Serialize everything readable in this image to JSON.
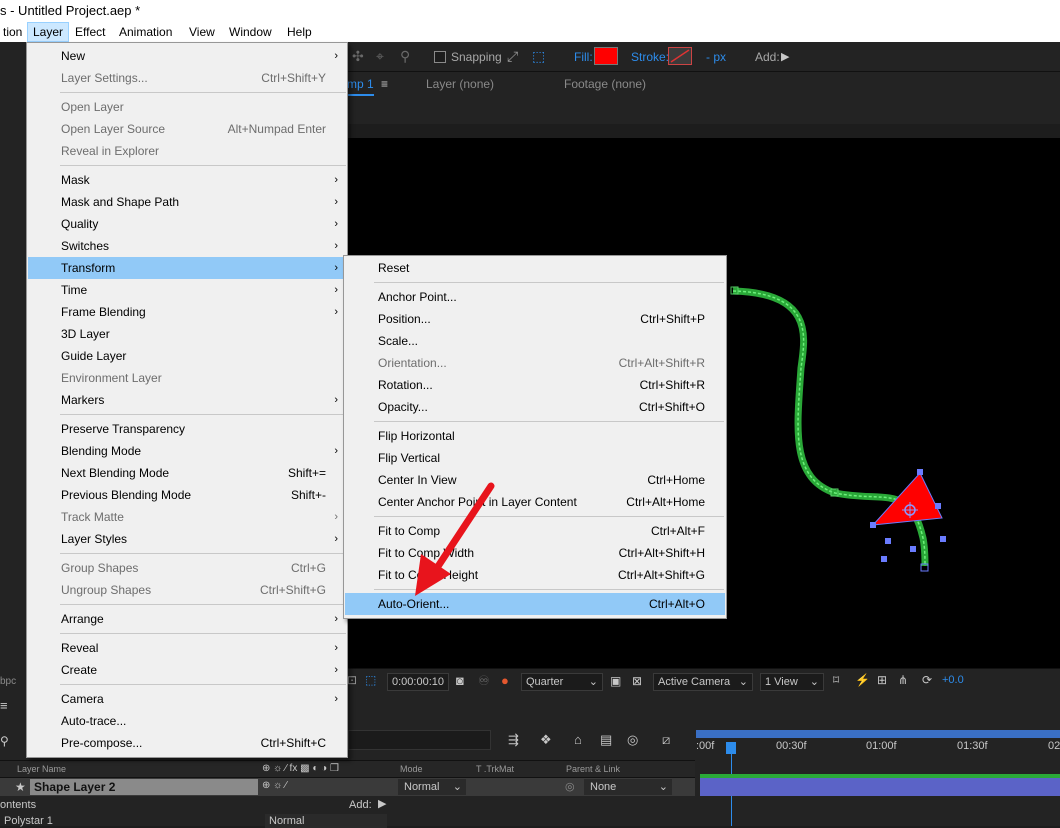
{
  "app": {
    "title": "s - Untitled Project.aep *"
  },
  "menubar": [
    "tion",
    "Layer",
    "Effect",
    "Animation",
    "View",
    "Window",
    "Help"
  ],
  "toolbar": {
    "snapping_label": "Snapping",
    "fill_label": "Fill:",
    "fill_color": "#ff0000",
    "stroke_label": "Stroke:",
    "stroke_width": "-  px",
    "add_label": "Add:"
  },
  "viewer": {
    "tabs": [
      "mp 1",
      "Layer  (none)",
      "Footage  (none)"
    ],
    "timecode": "0:00:00:10",
    "resolution": "Quarter",
    "camera": "Active Camera",
    "views": "1 View",
    "exposure": "+0.0",
    "bpc": "bpc"
  },
  "layer_menu": {
    "items": [
      {
        "label": "New",
        "shortcut": "",
        "submenu": true,
        "disabled": false
      },
      {
        "label": "Layer Settings...",
        "shortcut": "Ctrl+Shift+Y",
        "submenu": false,
        "disabled": true
      },
      {
        "label": "Open Layer",
        "shortcut": "",
        "submenu": false,
        "disabled": true
      },
      {
        "label": "Open Layer Source",
        "shortcut": "Alt+Numpad Enter",
        "submenu": false,
        "disabled": true
      },
      {
        "label": "Reveal in Explorer",
        "shortcut": "",
        "submenu": false,
        "disabled": true
      },
      {
        "label": "Mask",
        "shortcut": "",
        "submenu": true,
        "disabled": false
      },
      {
        "label": "Mask and Shape Path",
        "shortcut": "",
        "submenu": true,
        "disabled": false
      },
      {
        "label": "Quality",
        "shortcut": "",
        "submenu": true,
        "disabled": false
      },
      {
        "label": "Switches",
        "shortcut": "",
        "submenu": true,
        "disabled": false
      },
      {
        "label": "Transform",
        "shortcut": "",
        "submenu": true,
        "disabled": false
      },
      {
        "label": "Time",
        "shortcut": "",
        "submenu": true,
        "disabled": false
      },
      {
        "label": "Frame Blending",
        "shortcut": "",
        "submenu": true,
        "disabled": false
      },
      {
        "label": "3D Layer",
        "shortcut": "",
        "submenu": false,
        "disabled": false
      },
      {
        "label": "Guide Layer",
        "shortcut": "",
        "submenu": false,
        "disabled": false
      },
      {
        "label": "Environment Layer",
        "shortcut": "",
        "submenu": false,
        "disabled": true
      },
      {
        "label": "Markers",
        "shortcut": "",
        "submenu": true,
        "disabled": false
      },
      {
        "label": "Preserve Transparency",
        "shortcut": "",
        "submenu": false,
        "disabled": false
      },
      {
        "label": "Blending Mode",
        "shortcut": "",
        "submenu": true,
        "disabled": false
      },
      {
        "label": "Next Blending Mode",
        "shortcut": "Shift+=",
        "submenu": false,
        "disabled": false
      },
      {
        "label": "Previous Blending Mode",
        "shortcut": "Shift+-",
        "submenu": false,
        "disabled": false
      },
      {
        "label": "Track Matte",
        "shortcut": "",
        "submenu": true,
        "disabled": true
      },
      {
        "label": "Layer Styles",
        "shortcut": "",
        "submenu": true,
        "disabled": false
      },
      {
        "label": "Group Shapes",
        "shortcut": "Ctrl+G",
        "submenu": false,
        "disabled": true
      },
      {
        "label": "Ungroup Shapes",
        "shortcut": "Ctrl+Shift+G",
        "submenu": false,
        "disabled": true
      },
      {
        "label": "Arrange",
        "shortcut": "",
        "submenu": true,
        "disabled": false
      },
      {
        "label": "Reveal",
        "shortcut": "",
        "submenu": true,
        "disabled": false
      },
      {
        "label": "Create",
        "shortcut": "",
        "submenu": true,
        "disabled": false
      },
      {
        "label": "Camera",
        "shortcut": "",
        "submenu": true,
        "disabled": false
      },
      {
        "label": "Auto-trace...",
        "shortcut": "",
        "submenu": false,
        "disabled": false
      },
      {
        "label": "Pre-compose...",
        "shortcut": "Ctrl+Shift+C",
        "submenu": false,
        "disabled": false
      }
    ]
  },
  "transform_menu": {
    "items": [
      {
        "label": "Reset",
        "shortcut": "",
        "disabled": false
      },
      {
        "label": "Anchor Point...",
        "shortcut": "",
        "disabled": false
      },
      {
        "label": "Position...",
        "shortcut": "Ctrl+Shift+P",
        "disabled": false
      },
      {
        "label": "Scale...",
        "shortcut": "",
        "disabled": false
      },
      {
        "label": "Orientation...",
        "shortcut": "Ctrl+Alt+Shift+R",
        "disabled": true
      },
      {
        "label": "Rotation...",
        "shortcut": "Ctrl+Shift+R",
        "disabled": false
      },
      {
        "label": "Opacity...",
        "shortcut": "Ctrl+Shift+O",
        "disabled": false
      },
      {
        "label": "Flip Horizontal",
        "shortcut": "",
        "disabled": false
      },
      {
        "label": "Flip Vertical",
        "shortcut": "",
        "disabled": false
      },
      {
        "label": "Center In View",
        "shortcut": "Ctrl+Home",
        "disabled": false
      },
      {
        "label": "Center Anchor Point in Layer Content",
        "shortcut": "Ctrl+Alt+Home",
        "disabled": false
      },
      {
        "label": "Fit to Comp",
        "shortcut": "Ctrl+Alt+F",
        "disabled": false
      },
      {
        "label": "Fit to Comp Width",
        "shortcut": "Ctrl+Alt+Shift+H",
        "disabled": false
      },
      {
        "label": "Fit to Comp Height",
        "shortcut": "Ctrl+Alt+Shift+G",
        "disabled": false
      },
      {
        "label": "Auto-Orient...",
        "shortcut": "Ctrl+Alt+O",
        "disabled": false
      }
    ]
  },
  "timeline": {
    "columns": [
      "Layer Name",
      "Mode",
      "T  .TrkMat",
      "Parent & Link"
    ],
    "layer_name": "Shape Layer 2",
    "mode": "Normal",
    "parent": "None",
    "contents_label": "ontents",
    "add_label": "Add:",
    "polystar_label": "Polystar 1",
    "polystar_mode": "Normal",
    "ruler_labels": [
      ":00f",
      "00:30f",
      "01:00f",
      "01:30f",
      "02"
    ]
  }
}
